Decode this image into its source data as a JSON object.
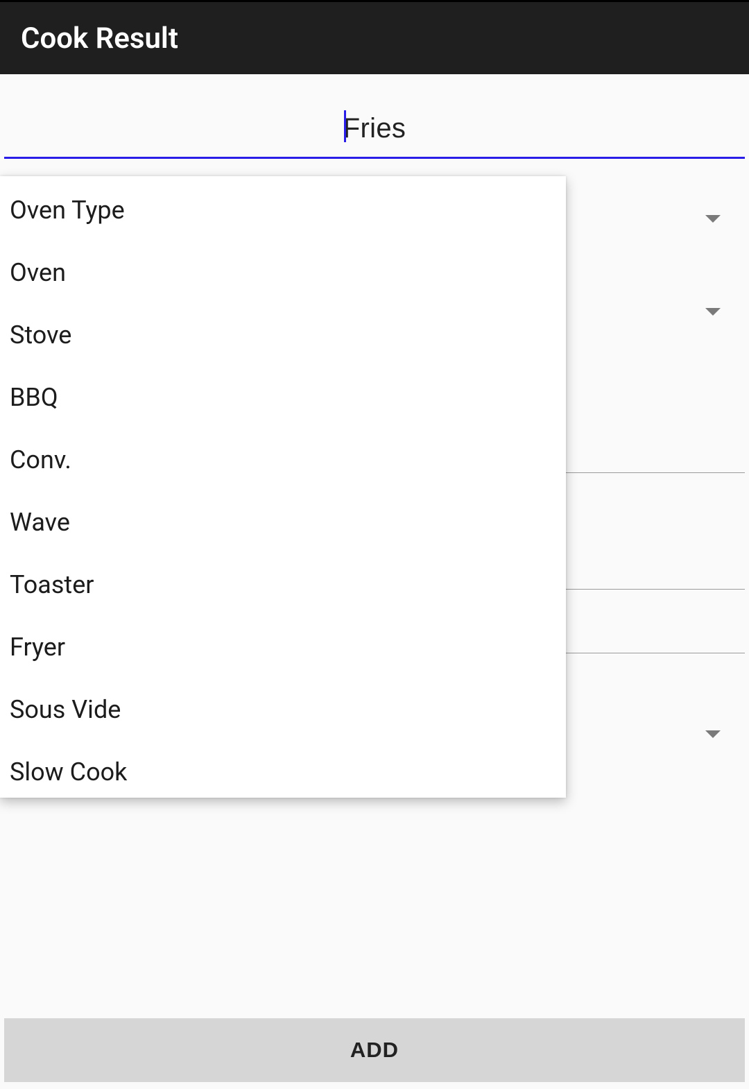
{
  "header": {
    "title": "Cook Result"
  },
  "input": {
    "value": "Fries"
  },
  "popup": {
    "items": [
      {
        "label": "Oven Type"
      },
      {
        "label": "Oven"
      },
      {
        "label": "Stove"
      },
      {
        "label": "BBQ"
      },
      {
        "label": "Conv."
      },
      {
        "label": "Wave"
      },
      {
        "label": "Toaster"
      },
      {
        "label": "Fryer"
      },
      {
        "label": "Sous Vide"
      },
      {
        "label": "Slow Cook"
      }
    ]
  },
  "actions": {
    "add_label": "ADD"
  }
}
